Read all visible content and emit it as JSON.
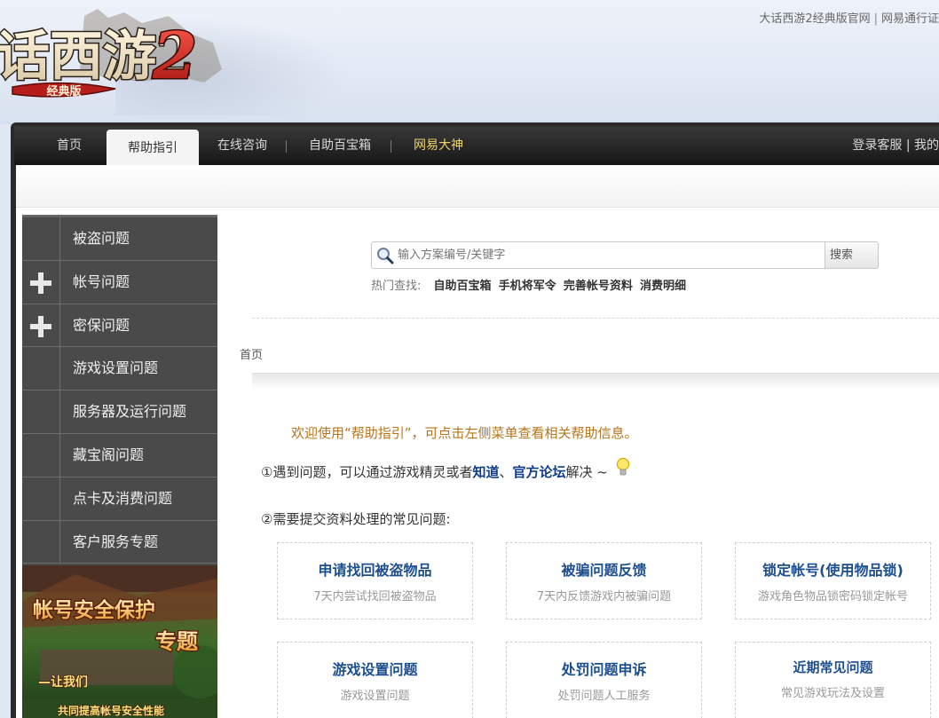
{
  "banner": {
    "logo_text": "话西游2",
    "logo_sub": "经典版",
    "top_links": [
      "大话西游2经典版官网",
      "网易通行证"
    ]
  },
  "nav": {
    "items": [
      "首页",
      "帮助指引",
      "在线咨询",
      "自助百宝箱",
      "网易大神"
    ],
    "active_index": 1,
    "right_text": "登录客服 | 我的"
  },
  "sidebar": {
    "items": [
      {
        "label": "被盗问题",
        "expandable": false
      },
      {
        "label": "帐号问题",
        "expandable": true
      },
      {
        "label": "密保问题",
        "expandable": true
      },
      {
        "label": "游戏设置问题",
        "expandable": false
      },
      {
        "label": "服务器及运行问题",
        "expandable": false
      },
      {
        "label": "藏宝阁问题",
        "expandable": false
      },
      {
        "label": "点卡及消费问题",
        "expandable": false
      },
      {
        "label": "客户服务专题",
        "expandable": false
      }
    ],
    "promo": {
      "title_line1": "帐号安全保护",
      "title_line2": "专题",
      "sub_line": "—让我们",
      "bottom_line": "共同提高帐号安全性能"
    }
  },
  "search": {
    "placeholder": "输入方案编号/关键字",
    "button_label": "搜索",
    "hot_label": "热门查找:",
    "hot_links": [
      "自助百宝箱",
      "手机将军令",
      "完善帐号资料",
      "消费明细"
    ]
  },
  "breadcrumb": {
    "home": "首页"
  },
  "main": {
    "welcome": "欢迎使用“帮助指引”，可点击左侧菜单查看相关帮助信息。",
    "line1_prefix": "①遇到问题，可以通过游戏精灵或者",
    "line1_link1": "知道",
    "line1_sep": "、",
    "line1_link2": "官方论坛",
    "line1_suffix": "解决 ~",
    "line2": "②需要提交资料处理的常见问题:",
    "cards": [
      {
        "title": "申请找回被盗物品",
        "desc": "7天内尝试找回被盗物品"
      },
      {
        "title": "被骗问题反馈",
        "desc": "7天内反馈游戏内被骗问题"
      },
      {
        "title": "锁定帐号(使用物品锁)",
        "desc": "游戏角色物品锁密码锁定帐号"
      },
      {
        "title": "游戏设置问题",
        "desc": "游戏设置问题"
      },
      {
        "title": "处罚问题申诉",
        "desc": "处罚问题人工服务"
      },
      {
        "title": "近期常见问题",
        "desc": "常见游戏玩法及设置"
      }
    ]
  },
  "colors": {
    "nav_bg": "#1c1c1c",
    "sidebar_bg": "#4a4a4a",
    "link_blue": "#1d4e8f",
    "welcome_orange": "#b8741a",
    "nav_gold": "#f0d46a"
  }
}
